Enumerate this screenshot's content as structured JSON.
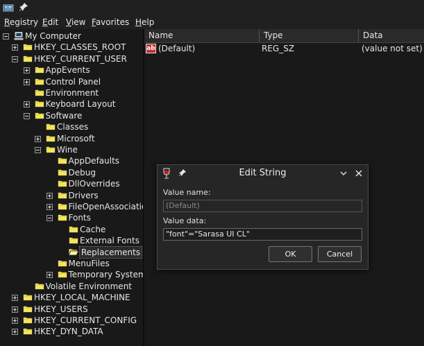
{
  "menubar": {
    "items": [
      {
        "label": "Registry",
        "u": "R",
        "rest": "egistry"
      },
      {
        "label": "Edit",
        "u": "E",
        "rest": "dit"
      },
      {
        "label": "View",
        "u": "V",
        "rest": "iew"
      },
      {
        "label": "Favorites",
        "u": "F",
        "rest": "avorites"
      },
      {
        "label": "Help",
        "u": "H",
        "rest": "elp"
      }
    ]
  },
  "tree": {
    "root": "My Computer",
    "nodes": [
      "HKEY_CLASSES_ROOT",
      "HKEY_CURRENT_USER",
      "AppEvents",
      "Control Panel",
      "Environment",
      "Keyboard Layout",
      "Software",
      "Classes",
      "Microsoft",
      "Wine",
      "AppDefaults",
      "Debug",
      "DllOverrides",
      "Drivers",
      "FileOpenAssociations",
      "Fonts",
      "Cache",
      "External Fonts",
      "Replacements",
      "MenuFiles",
      "Temporary System F",
      "Volatile Environment",
      "HKEY_LOCAL_MACHINE",
      "HKEY_USERS",
      "HKEY_CURRENT_CONFIG",
      "HKEY_DYN_DATA"
    ]
  },
  "list": {
    "headers": [
      "Name",
      "Type",
      "Data"
    ],
    "rows": [
      {
        "icon": "string-value-icon",
        "icon_text": "ab",
        "name": "(Default)",
        "type": "REG_SZ",
        "data": "(value not set)"
      }
    ]
  },
  "dialog": {
    "title": "Edit String",
    "value_name_label": "Value name:",
    "value_name": "(Default)",
    "value_data_label": "Value data:",
    "value_data": "\"font\"=\"Sarasa UI CL\"",
    "ok": "OK",
    "cancel": "Cancel"
  },
  "colors": {
    "folder": "#f2e45c",
    "accent_red": "#c62f2f"
  }
}
